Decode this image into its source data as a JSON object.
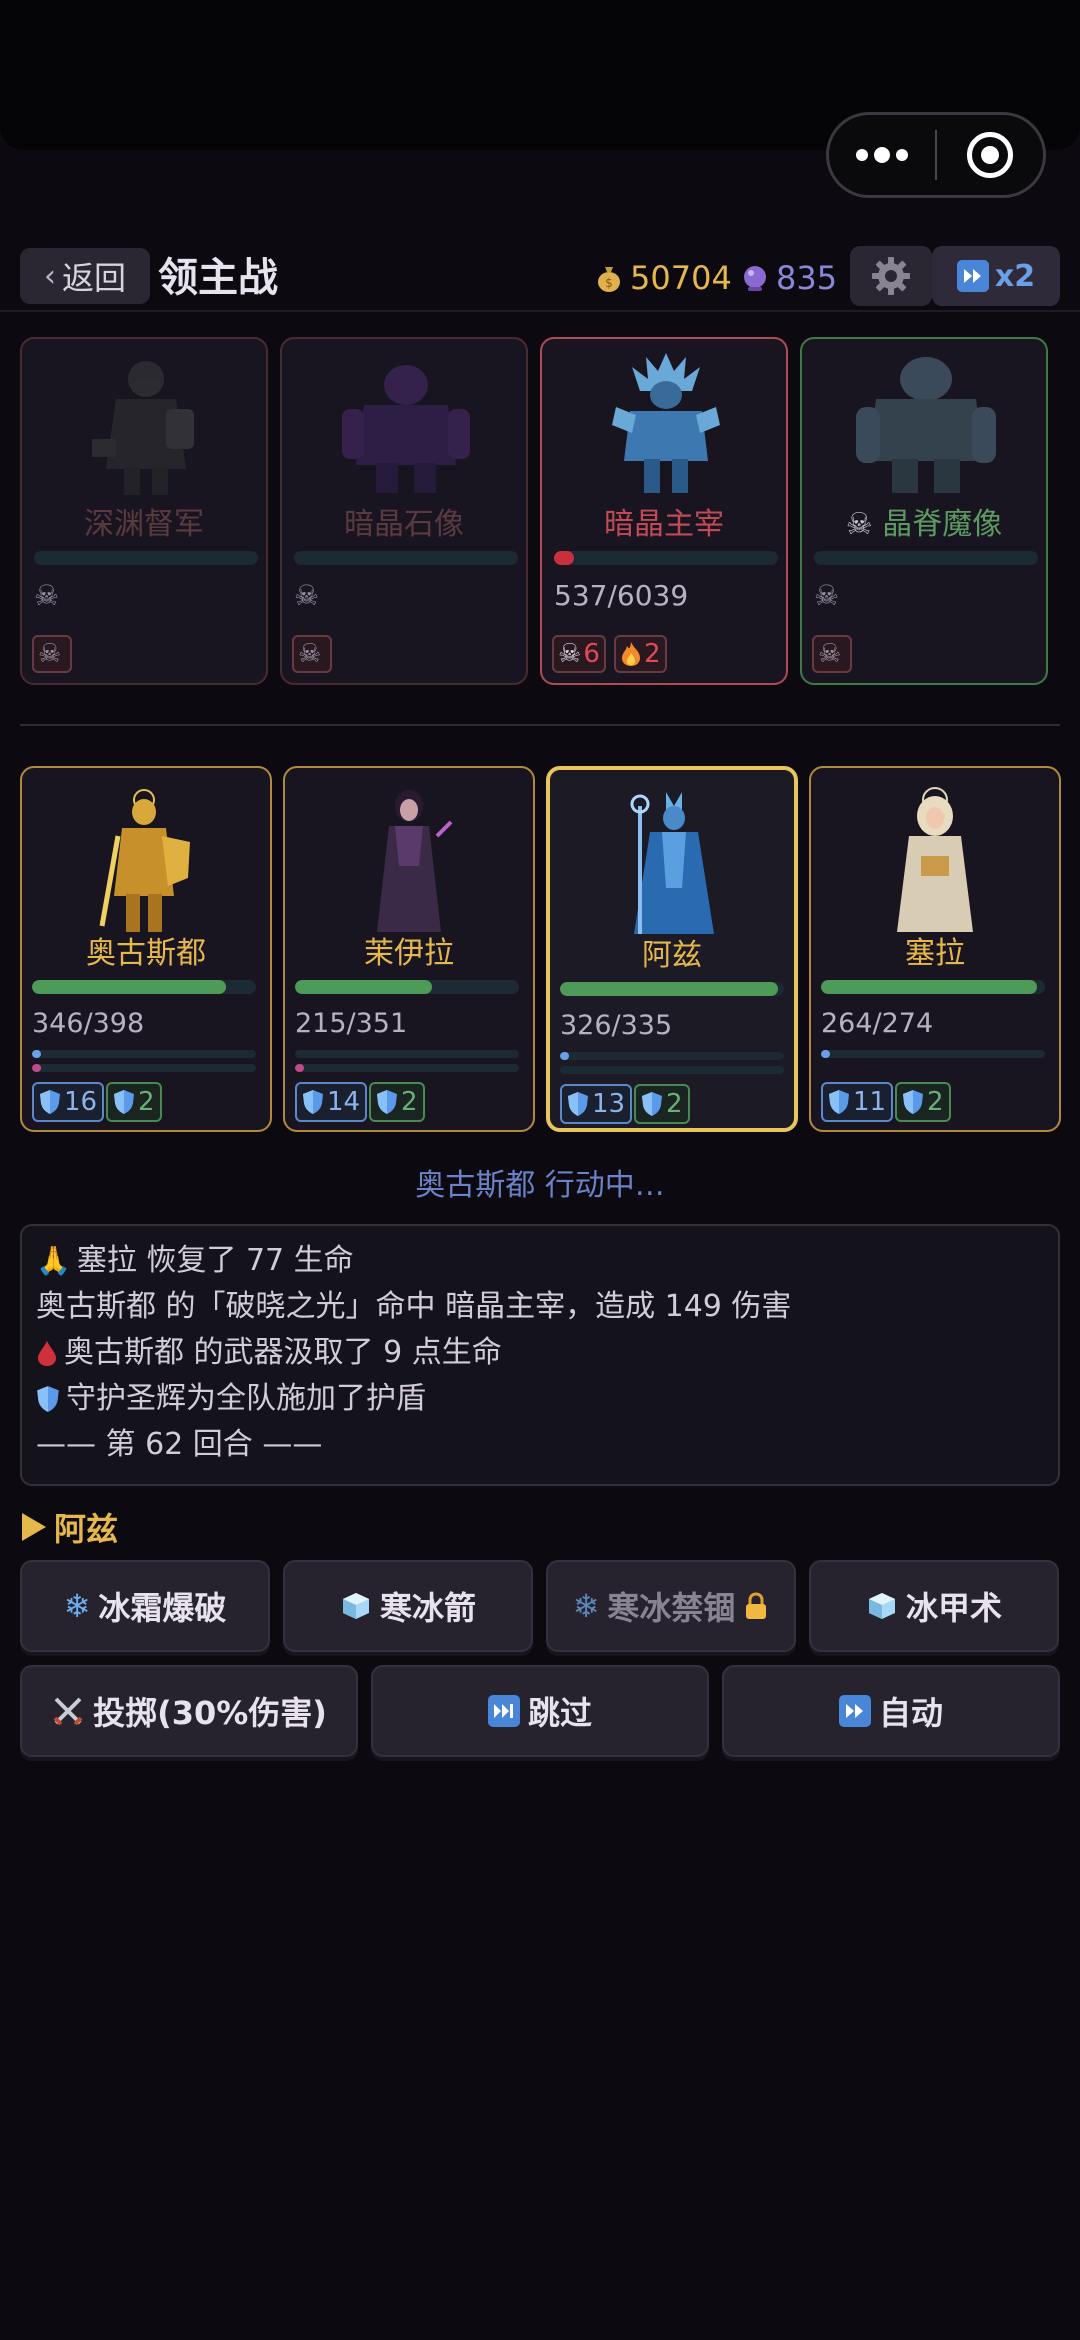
{
  "topbar": {
    "back_label": "返回",
    "title": "领主战",
    "gold": "50704",
    "gems": "835",
    "speed_label": "x2"
  },
  "enemies": [
    {
      "name": "深渊督军",
      "status": "dead",
      "hp_text": "",
      "hp_fraction": 0
    },
    {
      "name": "暗晶石像",
      "status": "dead",
      "hp_text": "",
      "hp_fraction": 0
    },
    {
      "name": "暗晶主宰",
      "status": "alive",
      "hp_text": "537/6039",
      "hp_fraction": 0.089,
      "debuffs": [
        {
          "icon": "skull-icon",
          "count": "6"
        },
        {
          "icon": "fire-icon",
          "count": "2"
        }
      ]
    },
    {
      "name": "晶脊魔像",
      "status": "dead",
      "hp_text": "",
      "hp_fraction": 0
    }
  ],
  "heroes": [
    {
      "name": "奥古斯都",
      "hp_text": "346/398",
      "hp_fraction": 0.868,
      "shield_blue": "16",
      "shield_green": "2",
      "active": false
    },
    {
      "name": "茉伊拉",
      "hp_text": "215/351",
      "hp_fraction": 0.612,
      "shield_blue": "14",
      "shield_green": "2",
      "active": false
    },
    {
      "name": "阿兹",
      "hp_text": "326/335",
      "hp_fraction": 0.973,
      "shield_blue": "13",
      "shield_green": "2",
      "active": true
    },
    {
      "name": "塞拉",
      "hp_text": "264/274",
      "hp_fraction": 0.963,
      "shield_blue": "11",
      "shield_green": "2",
      "active": false
    }
  ],
  "action_status": "奥古斯都 行动中…",
  "log": [
    {
      "icon": "pray-icon",
      "text": "塞拉 恢复了 77 生命"
    },
    {
      "icon": "",
      "text": "奥古斯都 的「破晓之光」命中 暗晶主宰，造成 149 伤害"
    },
    {
      "icon": "blood-drop-icon",
      "text": "奥古斯都 的武器汲取了 9 点生命"
    },
    {
      "icon": "shield-icon",
      "text": "守护圣辉为全队施加了护盾"
    },
    {
      "icon": "",
      "text": "—— 第 62 回合 ——"
    }
  ],
  "turn_hero": "阿兹",
  "skills": [
    {
      "icon": "snowflake-icon",
      "label": "冰霜爆破",
      "locked": false
    },
    {
      "icon": "ice-cube-icon",
      "label": "寒冰箭",
      "locked": false
    },
    {
      "icon": "snowflake-icon",
      "label": "寒冰禁锢",
      "locked": true
    },
    {
      "icon": "ice-cube-icon",
      "label": "冰甲术",
      "locked": false
    }
  ],
  "actions": [
    {
      "icon": "crossed-swords-icon",
      "label": "投掷(30%伤害)"
    },
    {
      "icon": "skip-icon",
      "label": "跳过"
    },
    {
      "icon": "fast-forward-icon",
      "label": "自动"
    }
  ],
  "colors": {
    "gold": "#e6b84c",
    "hp_green": "#4e9a58",
    "boss_red": "#c04a58",
    "active_border": "#e8c65a"
  }
}
